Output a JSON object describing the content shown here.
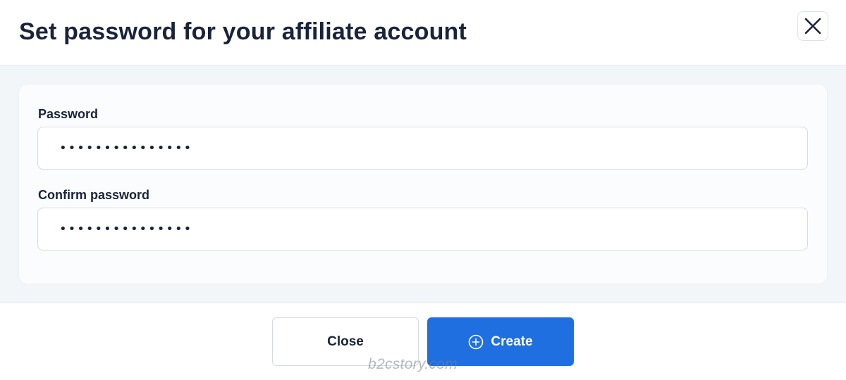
{
  "modal": {
    "title": "Set password for your affiliate account",
    "close_icon": "close-icon"
  },
  "form": {
    "password": {
      "label": "Password",
      "value": "•••••••••••••••"
    },
    "confirm_password": {
      "label": "Confirm password",
      "value": "•••••••••••••••"
    }
  },
  "footer": {
    "close_label": "Close",
    "create_label": "Create",
    "create_icon": "plus-circle-icon"
  },
  "watermark": "b2cstory.com",
  "colors": {
    "primary": "#1f6fe0",
    "title_text": "#19233a",
    "body_background": "#f3f6f9",
    "border": "#d6dbe1"
  }
}
